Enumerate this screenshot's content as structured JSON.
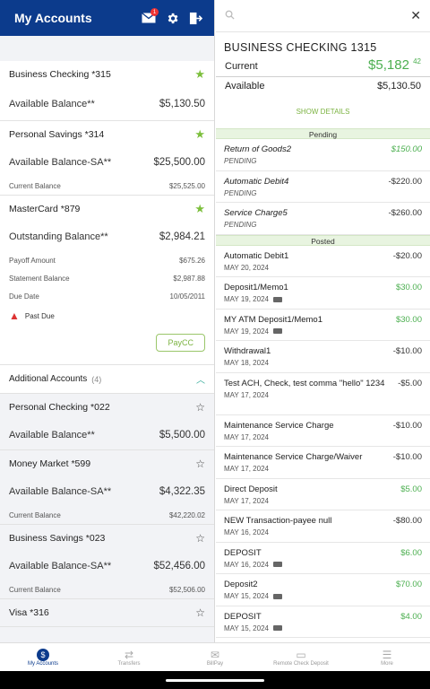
{
  "header": {
    "title": "My Accounts",
    "mail_badge": "1"
  },
  "accounts": {
    "checking": {
      "name": "Business Checking *315",
      "main_label": "Available Balance**",
      "main_value": "$5,130.50"
    },
    "savings": {
      "name": "Personal Savings *314",
      "main_label": "Available Balance-SA**",
      "main_value": "$25,500.00",
      "sub_label": "Current Balance",
      "sub_value": "$25,525.00"
    },
    "mastercard": {
      "name": "MasterCard *879",
      "main_label": "Outstanding Balance**",
      "main_value": "$2,984.21",
      "payoff_label": "Payoff Amount",
      "payoff_value": "$675.26",
      "stmt_label": "Statement Balance",
      "stmt_value": "$2,987.88",
      "due_label": "Due Date",
      "due_value": "10/05/2011",
      "alert": "Past Due",
      "button": "PayCC"
    }
  },
  "additional": {
    "label": "Additional Accounts",
    "count": "(4)"
  },
  "additional_accounts": {
    "pchecking": {
      "name": "Personal Checking *022",
      "main_label": "Available Balance**",
      "main_value": "$5,500.00"
    },
    "money": {
      "name": "Money Market *599",
      "main_label": "Available Balance-SA**",
      "main_value": "$4,322.35",
      "sub_label": "Current Balance",
      "sub_value": "$42,220.02"
    },
    "bsavings": {
      "name": "Business Savings *023",
      "main_label": "Available Balance-SA**",
      "main_value": "$52,456.00",
      "sub_label": "Current Balance",
      "sub_value": "$52,506.00"
    },
    "visa": {
      "name": "Visa *316"
    }
  },
  "detail": {
    "search_placeholder": "",
    "title": "BUSINESS CHECKING 1315",
    "current_label": "Current",
    "current_dollars": "$5,182",
    "current_cents": "42",
    "available_label": "Available",
    "available_value": "$5,130.50",
    "show_details": "SHOW DETAILS",
    "pending_label": "Pending",
    "posted_label": "Posted"
  },
  "pending": [
    {
      "name": "Return of Goods2",
      "status": "PENDING",
      "amount": "$150.00"
    },
    {
      "name": "Automatic Debit4",
      "status": "PENDING",
      "amount": "-$220.00"
    },
    {
      "name": "Service Charge5",
      "status": "PENDING",
      "amount": "-$260.00"
    }
  ],
  "posted": [
    {
      "name": "Automatic Debit1",
      "date": "MAY 20, 2024",
      "amount": "-$20.00"
    },
    {
      "name": "Deposit1/Memo1",
      "date": "MAY 19, 2024",
      "amount": "$30.00"
    },
    {
      "name": "MY ATM Deposit1/Memo1",
      "date": "MAY 19, 2024",
      "amount": "$30.00"
    },
    {
      "name": "Withdrawal1",
      "date": "MAY 18, 2024",
      "amount": "-$10.00"
    },
    {
      "name": "Test ACH, Check, test comma \"hello\" 1234",
      "date": "MAY 17, 2024",
      "amount": "-$5.00"
    },
    {
      "name": "Maintenance Service Charge",
      "date": "MAY 17, 2024",
      "amount": "-$10.00"
    },
    {
      "name": "Maintenance Service Charge/Waiver",
      "date": "MAY 17, 2024",
      "amount": "-$10.00"
    },
    {
      "name": "Direct Deposit",
      "date": "MAY 17, 2024",
      "amount": "$5.00"
    },
    {
      "name": "NEW Transaction-payee null",
      "date": "MAY 16, 2024",
      "amount": "-$80.00"
    },
    {
      "name": "DEPOSIT",
      "date": "MAY 16, 2024",
      "amount": "$6.00"
    },
    {
      "name": "Deposit2",
      "date": "MAY 15, 2024",
      "amount": "$70.00"
    },
    {
      "name": "DEPOSIT",
      "date": "MAY 15, 2024",
      "amount": "$4.00"
    }
  ],
  "nav": {
    "accounts": "My Accounts",
    "transfers": "Transfers",
    "billpay": "BillPay",
    "rcd": "Remote Check Deposit",
    "more": "More"
  },
  "colors": {
    "brand": "#0c3b8c",
    "positive": "#4caf50",
    "accent_green": "#7cb342",
    "alert": "#dd3333"
  }
}
